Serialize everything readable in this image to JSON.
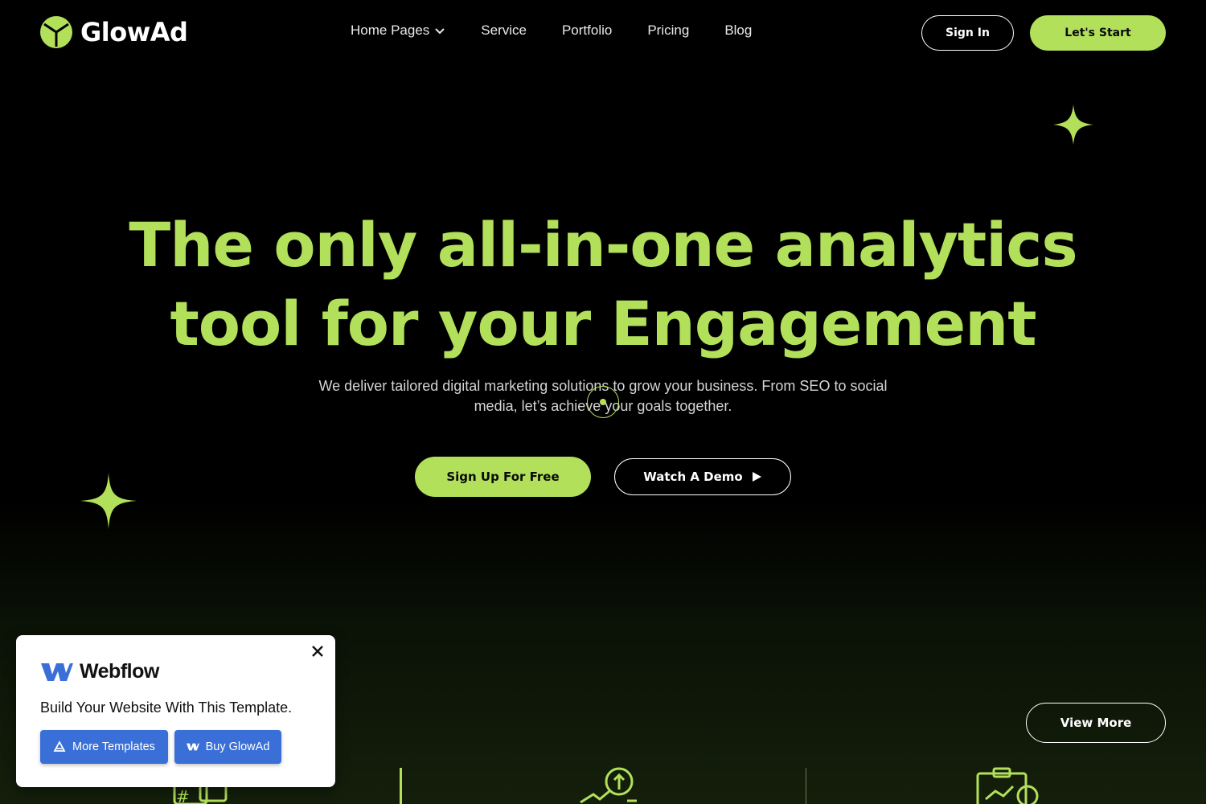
{
  "brand": {
    "name": "GlowAd",
    "accent": "#b2e05a"
  },
  "nav": {
    "items": [
      {
        "label": "Home Pages",
        "has_dropdown": true
      },
      {
        "label": "Service"
      },
      {
        "label": "Portfolio"
      },
      {
        "label": "Pricing"
      },
      {
        "label": "Blog"
      }
    ],
    "signin_label": "Sign In",
    "start_label": "Let's Start"
  },
  "hero": {
    "title_line1": "The only all-in-one analytics",
    "title_line2": "tool for your Engagement",
    "subtitle_line1": "We deliver tailored digital marketing solutions to grow your business. From SEO to social",
    "subtitle_line2": "media, let’s achieve your goals together.",
    "signup_label": "Sign Up For Free",
    "demo_label": "Watch A Demo"
  },
  "section": {
    "view_more_label": "View More"
  },
  "webflow_popup": {
    "logo_text": "Webflow",
    "message": "Build Your Website With This Template.",
    "more_templates_label": "More Templates",
    "buy_label": "Buy GlowAd"
  }
}
